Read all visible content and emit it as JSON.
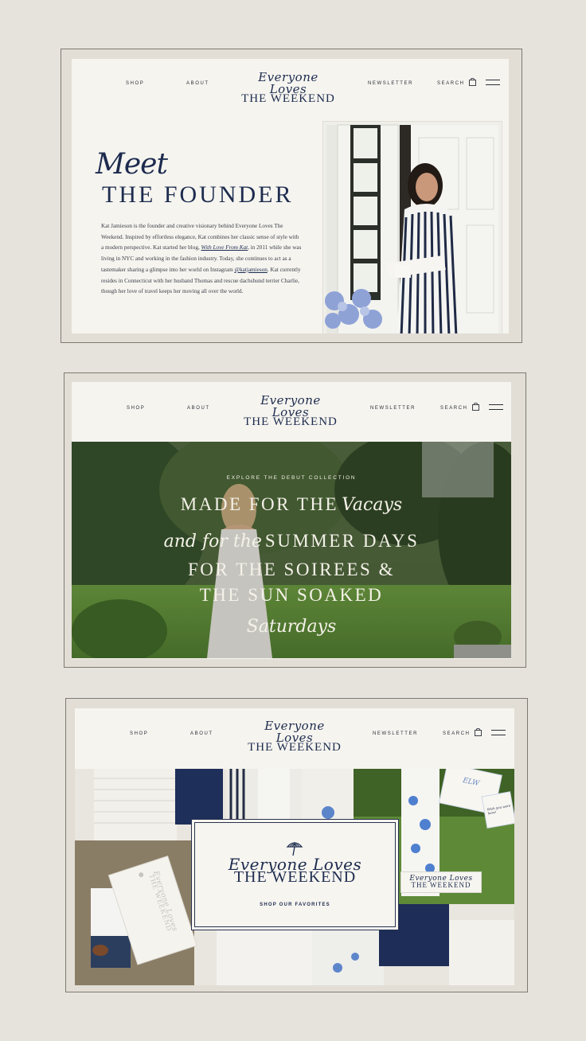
{
  "nav": {
    "shop": "SHOP",
    "about": "ABOUT",
    "newsletter": "NEWSLETTER",
    "search": "SEARCH",
    "cart_icon": "shopping-bag-icon",
    "menu_icon": "hamburger-menu-icon"
  },
  "brand": {
    "script": "Everyone Loves",
    "caps": "THE WEEKEND"
  },
  "about": {
    "heading_script": "Meet",
    "heading_caps": "THE FOUNDER",
    "bio_1": "Kat Jamieson is the founder and creative visionary behind Everyone Loves The Weekend. Inspired by effortless elegance, Kat combines her classic sense of style with a modern perspective. Kat started her blog, ",
    "bio_blog": "With Love From Kat",
    "bio_2": ", in 2011 while she was living in NYC and working in the fashion industry. Today, she continues to act as a tastemaker sharing a glimpse into her world on Instagram ",
    "bio_handle": "@katjamieson",
    "bio_3": ". Kat currently resides in Connecticut with her husband Thomas and rescue dachshund terrier Charlie, though her love of travel keeps her moving all over the world."
  },
  "hero": {
    "eyebrow": "EXPLORE THE DEBUT COLLECTION",
    "line1_caps": "MADE FOR THE",
    "line1_script": "Vacays",
    "line2_script": "and for the",
    "line2_caps": "SUMMER DAYS",
    "line3": "FOR THE SOIREES &",
    "line4": "THE SUN SOAKED",
    "line5_script": "Saturdays"
  },
  "shop_section": {
    "button": "SHOP OUR FAVORITES",
    "tag_script": "Everyone Loves",
    "tag_caps": "THE WEEKEND",
    "label_script": "Everyone Loves",
    "label_caps": "THE WEEKEND",
    "monogram": "ELW",
    "postcard_text": "Wish you were here!",
    "umbrella_icon": "beach-umbrella-icon"
  },
  "colors": {
    "navy": "#1d2b4e",
    "ivory": "#f5f4ef",
    "frame": "#e2ded6",
    "background": "#e6e3dd"
  }
}
